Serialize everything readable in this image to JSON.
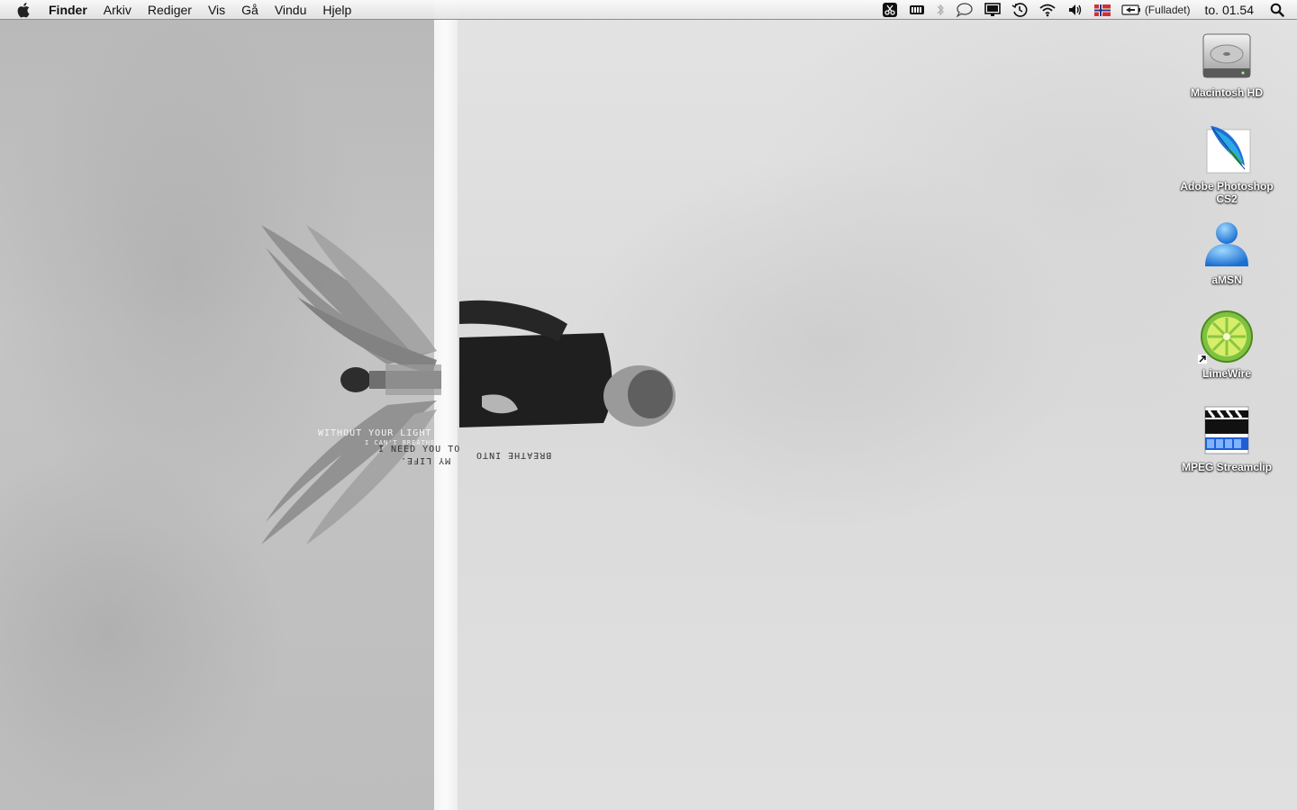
{
  "menubar": {
    "apple_icon": "apple-icon",
    "app_name": "Finder",
    "menus": [
      "Arkiv",
      "Rediger",
      "Vis",
      "Gå",
      "Vindu",
      "Hjelp"
    ],
    "status_icons": [
      "scissors-icon",
      "battery-bar-icon",
      "bluetooth-icon",
      "chat-bubble-icon",
      "display-icon",
      "time-machine-icon",
      "wifi-icon",
      "volume-icon",
      "norway-flag-icon",
      "battery-icon"
    ],
    "battery_status": "(Fulladet)",
    "clock": "to. 01.54",
    "spotlight_icon": "spotlight-search-icon"
  },
  "wallpaper": {
    "line1": "WITHOUT YOUR LIGHT",
    "line2": "I CAN'T BREATHE",
    "line3": "I NEED YOU TO",
    "line4": "BREATHE INTO",
    "line5": "MY LIFE."
  },
  "desktop_icons": [
    {
      "label": "Macintosh HD",
      "icon": "hard-drive-icon"
    },
    {
      "label": "Adobe Photoshop CS2",
      "icon": "photoshop-feather-icon"
    },
    {
      "label": "aMSN",
      "icon": "amsn-buddy-icon"
    },
    {
      "label": "LimeWire",
      "icon": "limewire-icon"
    },
    {
      "label": "MPEG Streamclip",
      "icon": "clapperboard-icon"
    }
  ],
  "colors": {
    "accent_blue": "#1e6fd6",
    "limewire_green": "#7fc241",
    "flag_red": "#d32f2f"
  }
}
